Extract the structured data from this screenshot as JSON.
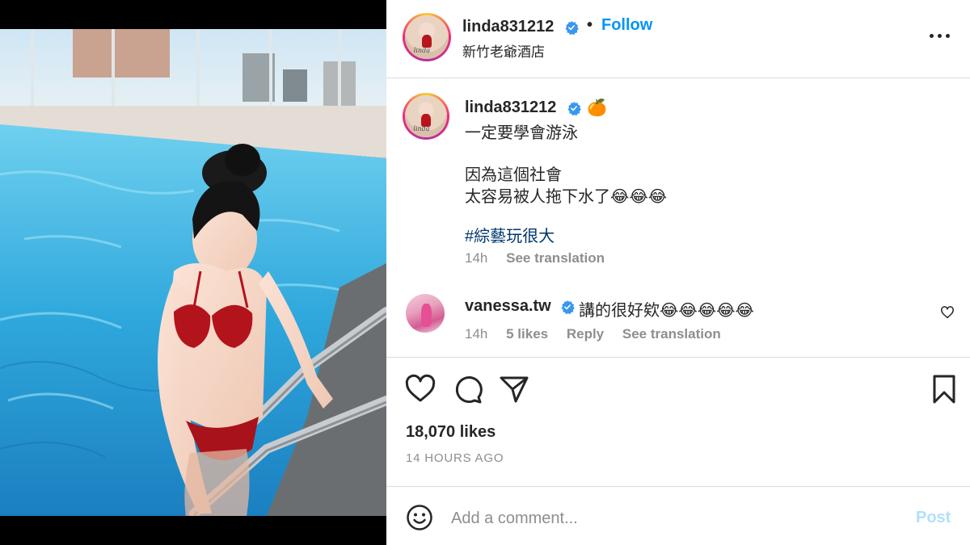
{
  "post": {
    "username": "linda831212",
    "follow_label": "Follow",
    "separator": "•",
    "location": "新竹老爺酒店",
    "caption": {
      "emoji": "🍊",
      "line1": "一定要學會游泳",
      "line2": "因為這個社會",
      "line3": "太容易被人拖下水了😂😂😂",
      "hashtag": "#綜藝玩很大",
      "time": "14h",
      "see_translation": "See translation"
    },
    "comment": {
      "username": "vanessa.tw",
      "text": "講的很好欸😂😂😂😂😂",
      "time": "14h",
      "likes": "5 likes",
      "reply": "Reply",
      "see_translation": "See translation"
    },
    "likes": "18,070 likes",
    "timestamp": "14 HOURS AGO",
    "add_comment_placeholder": "Add a comment...",
    "post_label": "Post",
    "avatar_signature": "linda"
  },
  "colors": {
    "accent_blue": "#0095f6",
    "hashtag": "#00376b",
    "muted": "#8e8e8e",
    "post_disabled": "#b2dffc",
    "verified": "#3897f0"
  },
  "icons": {
    "more": "more-horizontal-icon",
    "like": "heart-outline-icon",
    "comment": "speech-bubble-icon",
    "share": "paper-plane-icon",
    "save": "bookmark-icon",
    "emoji": "smiley-face-icon",
    "verified": "verified-badge-icon"
  }
}
